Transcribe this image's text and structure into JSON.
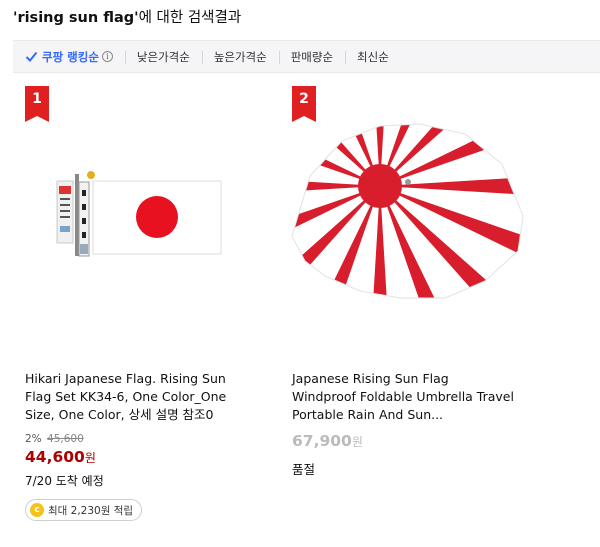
{
  "search": {
    "query": "'rising sun flag'",
    "suffix": "에 대한 검색결과"
  },
  "sort": {
    "active_label": "쿠팡 랭킹순",
    "info_symbol": "i",
    "options": [
      "낮은가격순",
      "높은가격순",
      "판매량순",
      "최신순"
    ],
    "accent_color": "#346aff"
  },
  "products": [
    {
      "rank": "1",
      "name": "Hikari Japanese Flag. Rising Sun Flag Set KK34-6, One Color_One Size, One Color, 상세 설명 참조0",
      "discount_rate": "2%",
      "original_price": "45,600",
      "price": "44,600",
      "price_unit": "원",
      "delivery": "7/20 도착 예정",
      "reward": "최대 2,230원 적립",
      "coin_symbol": "c",
      "image_icon": "japanese-flag-set-image"
    },
    {
      "rank": "2",
      "name": "Japanese Rising Sun Flag Windproof Foldable Umbrella Travel Portable Rain And Sun...",
      "price": "67,900",
      "price_unit": "원",
      "status": "품절",
      "image_icon": "rising-sun-umbrella-image"
    }
  ],
  "colors": {
    "rank_badge": "#e02020",
    "sale_price": "#ae0000",
    "soldout_price": "#bbbbbb"
  }
}
